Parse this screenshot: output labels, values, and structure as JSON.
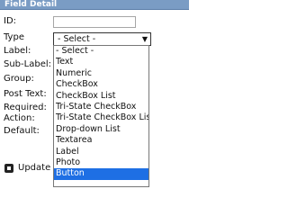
{
  "panel": {
    "title": "Field Detail"
  },
  "labels": {
    "id": "ID:",
    "type": "Type",
    "label": "Label:",
    "sub_label": "Sub-Label:",
    "group": "Group:",
    "post_text": "Post Text:",
    "required": "Required:",
    "action": "Action:",
    "default": "Default:"
  },
  "fields": {
    "id_value": ""
  },
  "type_select": {
    "selected": "- Select -",
    "options": [
      "- Select -",
      "Text",
      "Numeric",
      "CheckBox",
      "CheckBox List",
      "Tri-State CheckBox",
      "Tri-State CheckBox List",
      "Drop-down List",
      "Textarea",
      "Label",
      "Photo",
      "Button"
    ],
    "highlighted_option": "Button"
  },
  "update_button": {
    "label": "Update F"
  },
  "colors": {
    "header": "#7a9cc4",
    "highlight": "#1e6fe4"
  },
  "icons": {
    "update": "update-icon",
    "dropdown": "chevron-down-icon"
  }
}
